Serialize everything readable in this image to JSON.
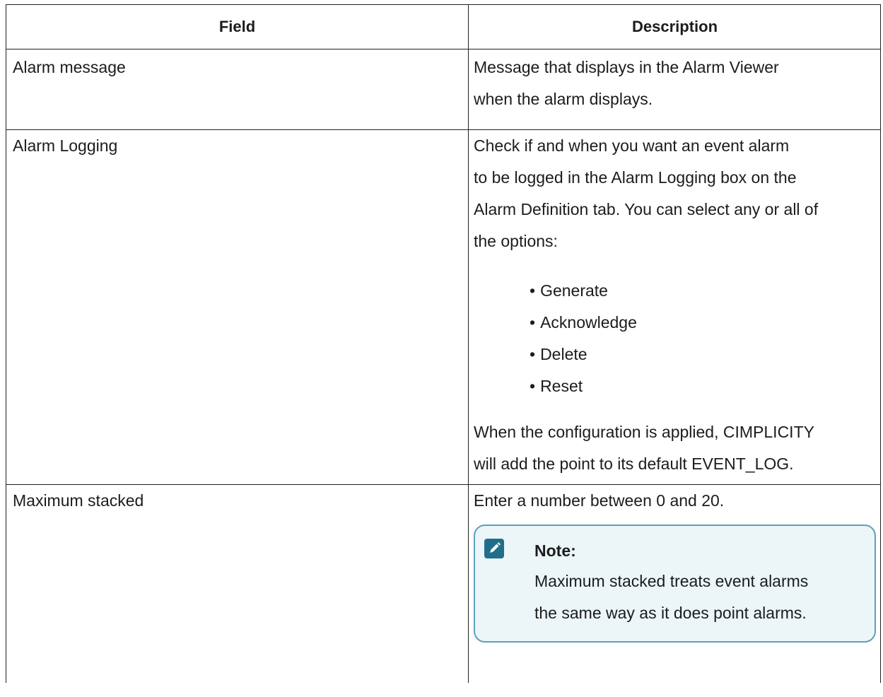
{
  "table": {
    "headers": {
      "field": "Field",
      "description": "Description"
    },
    "rows": [
      {
        "field": "Alarm message",
        "description_lines": [
          "Message that displays in the Alarm Viewer",
          "when the alarm displays."
        ]
      },
      {
        "field": "Alarm Logging",
        "description_lines": [
          "Check if and when you want an event alarm",
          "to be logged in the Alarm Logging box on the",
          "Alarm Definition tab. You can select any or all of",
          "the options:"
        ],
        "options": [
          "Generate",
          "Acknowledge",
          "Delete",
          "Reset"
        ],
        "after_lines": [
          "When the configuration is applied, CIMPLICITY",
          "will add the point to its default EVENT_LOG."
        ]
      },
      {
        "field": "Maximum stacked",
        "description_lines": [
          "Enter a number between 0 and 20."
        ],
        "note": {
          "icon": "pencil-icon",
          "title": "Note:",
          "lines": [
            "Maximum stacked treats event alarms",
            "the same way as it does point alarms."
          ]
        }
      }
    ]
  },
  "colors": {
    "note_border": "#5aa3b8",
    "note_background": "#ecf5f8",
    "note_icon": "#1f6f8b"
  }
}
